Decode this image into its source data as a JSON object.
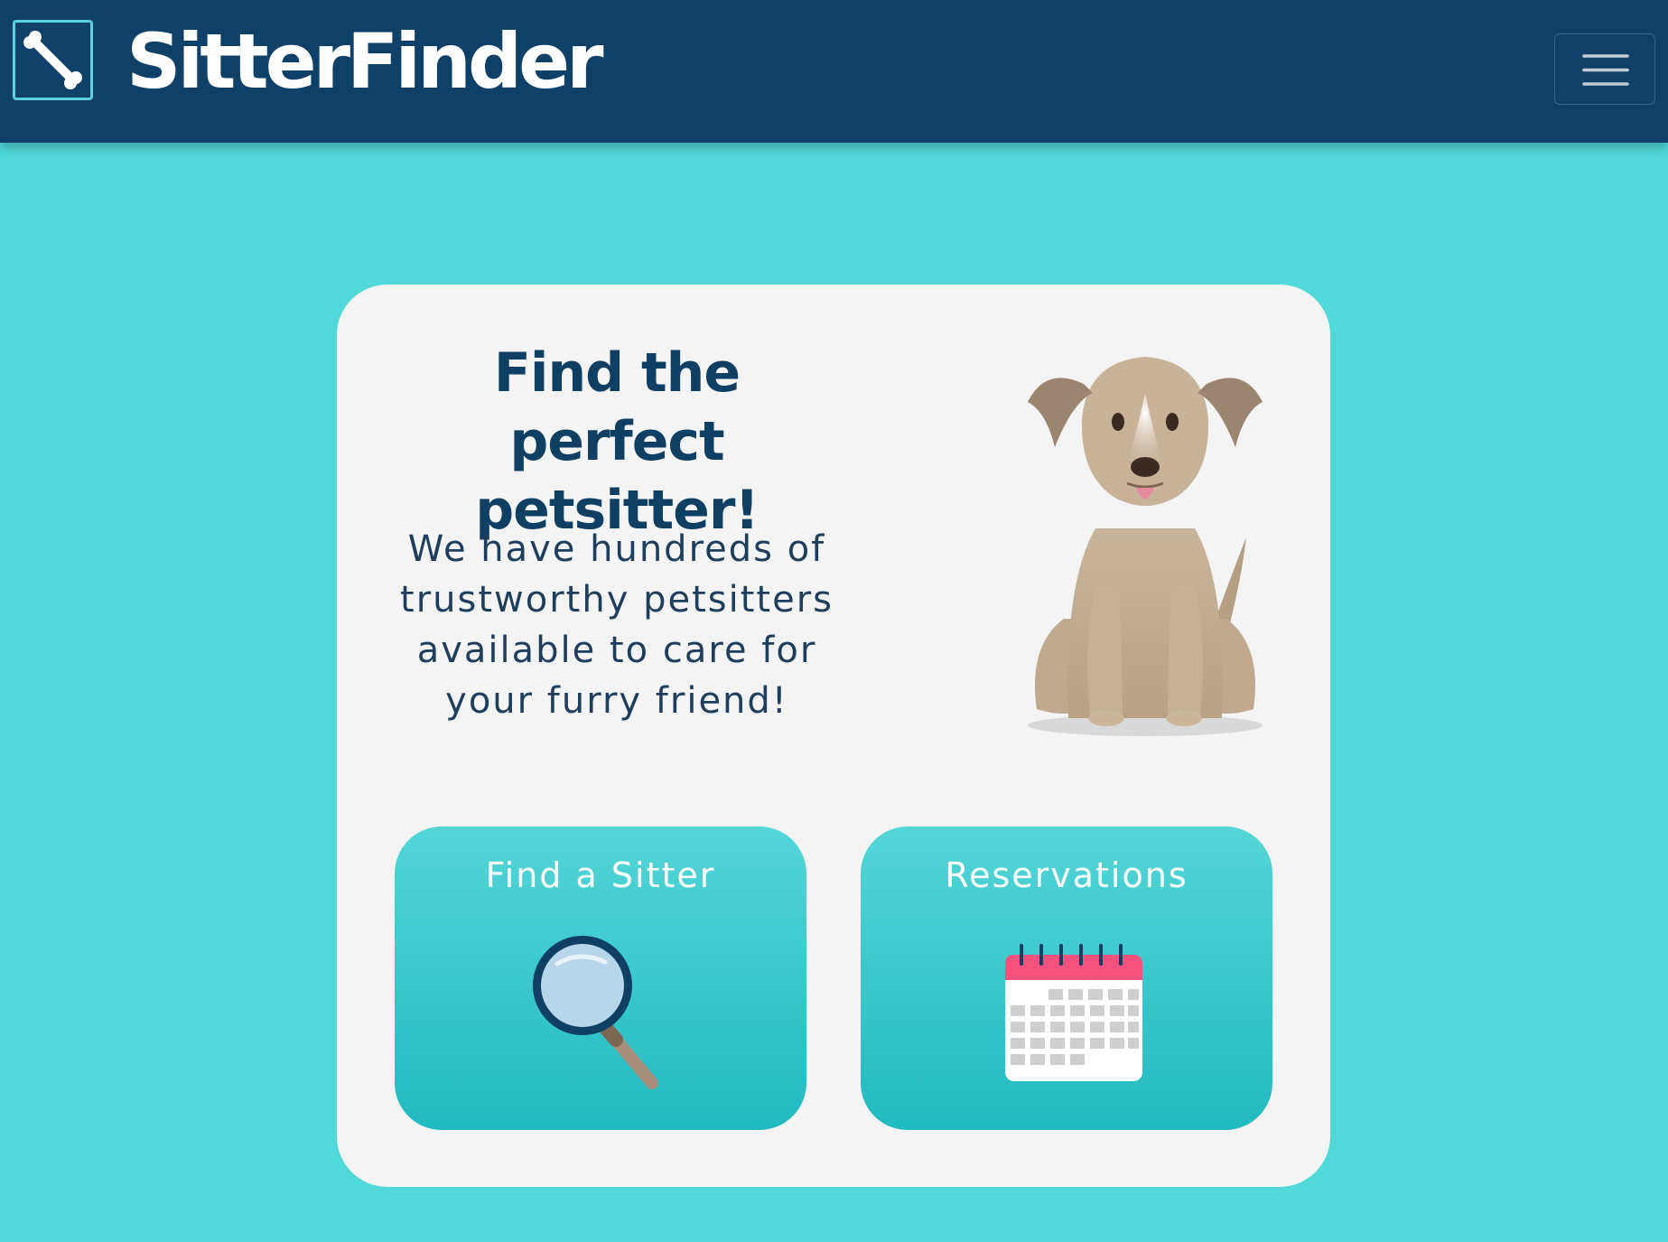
{
  "navbar": {
    "brand_name": "SitterFinder",
    "logo_icon": "bone-icon",
    "menu_icon": "hamburger-menu-icon"
  },
  "hero": {
    "headline": "Find the perfect petsitter!",
    "blurb": "We have hundreds of trustworthy petsitters available to care for your furry friend!",
    "illustration": "dog-illustration"
  },
  "actions": [
    {
      "label": "Find a Sitter",
      "icon": "magnifying-glass-icon"
    },
    {
      "label": "Reservations",
      "icon": "calendar-icon"
    }
  ],
  "colors": {
    "navbar": "#0f4168",
    "page_background": "#51d8d9",
    "card_background": "#f4f4f4",
    "heading_text": "#0f3f62",
    "tile_gradient_top": "#54d6d7",
    "tile_gradient_bottom": "#21bac1"
  }
}
